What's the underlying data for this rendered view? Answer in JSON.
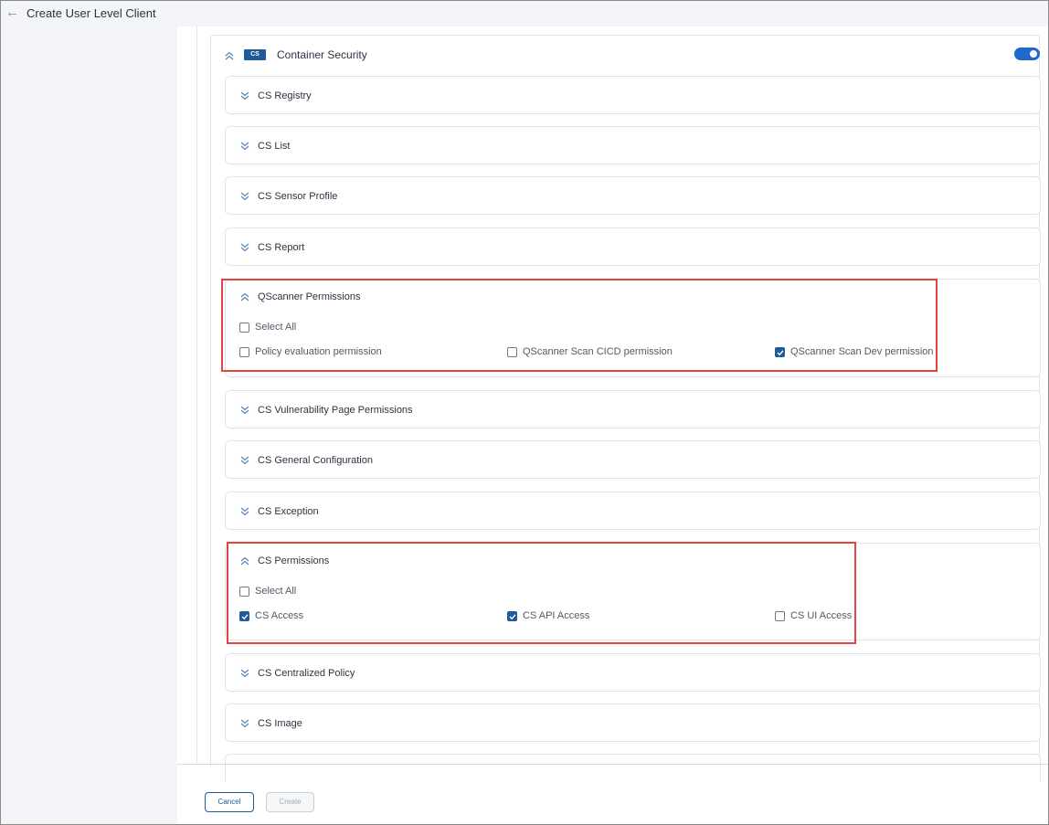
{
  "header": {
    "title": "Create User Level Client",
    "back_icon": "arrow-left-icon"
  },
  "module": {
    "badge": "CS",
    "title": "Container Security",
    "enabled": true
  },
  "sections": [
    {
      "title": "CS Registry",
      "expanded": false
    },
    {
      "title": "CS List",
      "expanded": false
    },
    {
      "title": "CS Sensor Profile",
      "expanded": false
    },
    {
      "title": "CS Report",
      "expanded": false
    },
    {
      "title": "QScanner Permissions",
      "expanded": true
    },
    {
      "title": "CS Vulnerability Page Permissions",
      "expanded": false
    },
    {
      "title": "CS General Configuration",
      "expanded": false
    },
    {
      "title": "CS Exception",
      "expanded": false
    },
    {
      "title": "CS Permissions",
      "expanded": true
    },
    {
      "title": "CS Centralized Policy",
      "expanded": false
    },
    {
      "title": "CS Image",
      "expanded": false
    }
  ],
  "qscanner": {
    "select_all": {
      "label": "Select All",
      "checked": false
    },
    "options": [
      {
        "label": "Policy evaluation permission",
        "checked": false
      },
      {
        "label": "QScanner Scan CICD permission",
        "checked": false
      },
      {
        "label": "QScanner Scan Dev permission",
        "checked": true
      }
    ]
  },
  "cs_permissions": {
    "select_all": {
      "label": "Select All",
      "checked": false
    },
    "options": [
      {
        "label": "CS Access",
        "checked": true
      },
      {
        "label": "CS API Access",
        "checked": true
      },
      {
        "label": "CS UI Access",
        "checked": false
      }
    ]
  },
  "footer": {
    "cancel_label": "Cancel",
    "create_label": "Create"
  },
  "colors": {
    "accent": "#1f5a99",
    "toggle_on": "#1f69c9",
    "highlight": "#e3443f"
  }
}
